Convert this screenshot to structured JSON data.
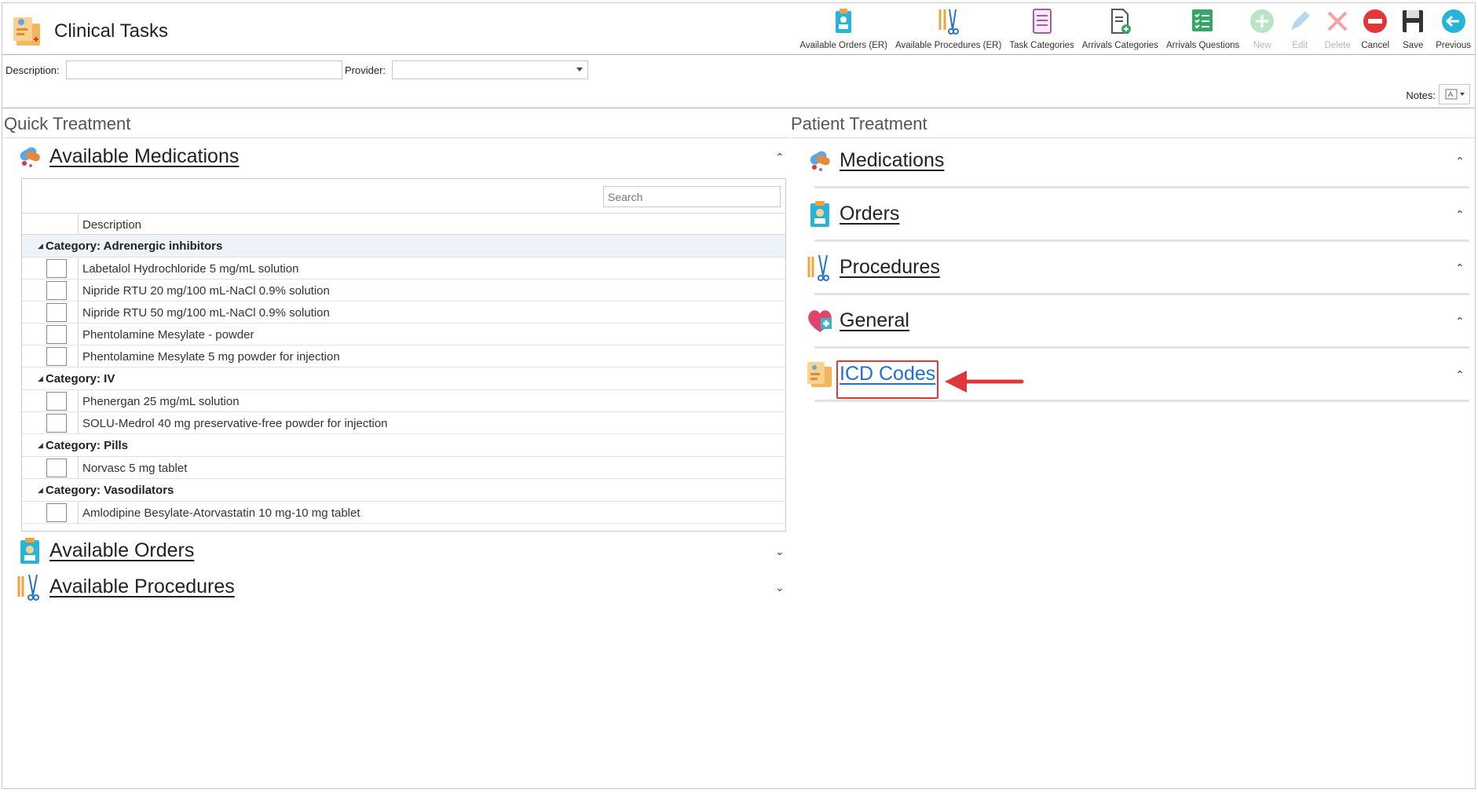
{
  "app": {
    "title": "Clinical Tasks"
  },
  "toolbar": [
    {
      "label": "Available Orders (ER)",
      "icon": "clipboard-icon",
      "enabled": true
    },
    {
      "label": "Available Procedures (ER)",
      "icon": "instruments-icon",
      "enabled": true
    },
    {
      "label": "Task Categories",
      "icon": "list-icon",
      "enabled": true
    },
    {
      "label": "Arrivals Categories",
      "icon": "document-add-icon",
      "enabled": true
    },
    {
      "label": "Arrivals Questions",
      "icon": "checklist-icon",
      "enabled": true
    },
    {
      "label": "New",
      "icon": "plus-icon",
      "enabled": false
    },
    {
      "label": "Edit",
      "icon": "pencil-icon",
      "enabled": false
    },
    {
      "label": "Delete",
      "icon": "x-icon",
      "enabled": false
    },
    {
      "label": "Cancel",
      "icon": "cancel-icon",
      "enabled": true
    },
    {
      "label": "Save",
      "icon": "save-icon",
      "enabled": true
    },
    {
      "label": "Previous",
      "icon": "back-arrow-icon",
      "enabled": true
    }
  ],
  "filters": {
    "description_label": "Description:",
    "description_value": "",
    "provider_label": "Provider:",
    "provider_value": "",
    "notes_label": "Notes:"
  },
  "quick_treatment": {
    "title": "Quick Treatment",
    "medications": {
      "title": "Available Medications",
      "search_placeholder": "Search",
      "column": "Description",
      "categories": [
        {
          "name": "Category: Adrenergic inhibitors",
          "items": [
            "Labetalol Hydrochloride 5 mg/mL solution",
            "Nipride RTU 20 mg/100 mL-NaCl 0.9% solution",
            "Nipride RTU 50 mg/100 mL-NaCl 0.9% solution",
            "Phentolamine Mesylate - powder",
            "Phentolamine Mesylate 5 mg powder for injection"
          ]
        },
        {
          "name": "Category: IV",
          "items": [
            "Phenergan 25 mg/mL solution",
            "SOLU-Medrol 40 mg preservative-free powder for injection"
          ]
        },
        {
          "name": "Category: Pills",
          "items": [
            "Norvasc 5 mg tablet"
          ]
        },
        {
          "name": "Category: Vasodilators",
          "items": [
            "Amlodipine Besylate-Atorvastatin 10 mg-10 mg tablet"
          ]
        }
      ]
    },
    "orders_title": "Available Orders",
    "procedures_title": "Available Procedures"
  },
  "patient_treatment": {
    "title": "Patient Treatment",
    "groups": [
      "Medications",
      "Orders",
      "Procedures",
      "General",
      "ICD Codes"
    ]
  },
  "colors": {
    "highlight": "#e0383a",
    "link_active": "#1f6fd6",
    "header_rule": "#9fb7d6"
  }
}
